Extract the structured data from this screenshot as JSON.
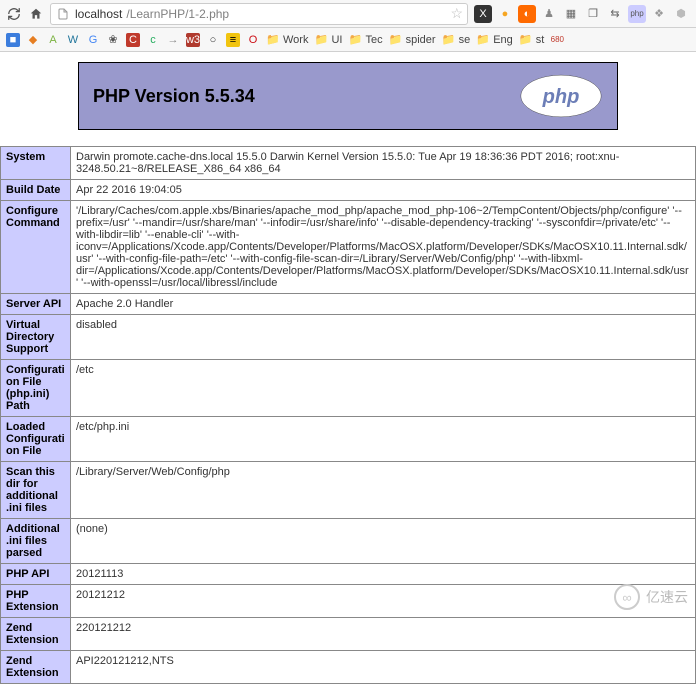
{
  "browser": {
    "url_host": "localhost",
    "url_path": "/LearnPHP/1-2.php",
    "extensions": [
      {
        "name": "x-ext",
        "glyph": "X",
        "bg": "#333",
        "fg": "#fff"
      },
      {
        "name": "orange-circle",
        "glyph": "●",
        "bg": "transparent",
        "fg": "#f6a623"
      },
      {
        "name": "orange-slash",
        "glyph": "◐",
        "bg": "#ff6a00",
        "fg": "#fff"
      },
      {
        "name": "chess",
        "glyph": "♟",
        "bg": "transparent",
        "fg": "#888"
      },
      {
        "name": "grid",
        "glyph": "▦",
        "bg": "transparent",
        "fg": "#666"
      },
      {
        "name": "window",
        "glyph": "❐",
        "bg": "transparent",
        "fg": "#666"
      },
      {
        "name": "arrows",
        "glyph": "⇆",
        "bg": "transparent",
        "fg": "#666"
      },
      {
        "name": "php",
        "glyph": "php",
        "bg": "#ccccff",
        "fg": "#555"
      },
      {
        "name": "grey1",
        "glyph": "❖",
        "bg": "transparent",
        "fg": "#999"
      },
      {
        "name": "grey2",
        "glyph": "⬢",
        "bg": "transparent",
        "fg": "#bbb"
      }
    ]
  },
  "bookmarks": [
    {
      "name": "blue-sq",
      "glyph": "■",
      "bg": "#3b7ddd",
      "fg": "#fff",
      "label": ""
    },
    {
      "name": "diamond",
      "glyph": "◆",
      "bg": "transparent",
      "fg": "#e67e22",
      "label": ""
    },
    {
      "name": "android",
      "glyph": "A",
      "bg": "transparent",
      "fg": "#7cb342",
      "label": ""
    },
    {
      "name": "wp",
      "glyph": "W",
      "bg": "transparent",
      "fg": "#21759b",
      "label": ""
    },
    {
      "name": "google",
      "glyph": "G",
      "bg": "transparent",
      "fg": "#4285f4",
      "label": ""
    },
    {
      "name": "paint",
      "glyph": "❀",
      "bg": "transparent",
      "fg": "#555",
      "label": ""
    },
    {
      "name": "c-red",
      "glyph": "C",
      "bg": "#c0392b",
      "fg": "#fff",
      "label": ""
    },
    {
      "name": "c-green",
      "glyph": "c",
      "bg": "transparent",
      "fg": "#27ae60",
      "label": ""
    },
    {
      "name": "arrow",
      "glyph": "→",
      "bg": "transparent",
      "fg": "#888",
      "label": ""
    },
    {
      "name": "w3",
      "glyph": "w3",
      "bg": "#b03a2e",
      "fg": "#fff",
      "label": ""
    },
    {
      "name": "github",
      "glyph": "○",
      "bg": "transparent",
      "fg": "#333",
      "label": ""
    },
    {
      "name": "yellow",
      "glyph": "≡",
      "bg": "#f1c40f",
      "fg": "#000",
      "label": ""
    },
    {
      "name": "opera",
      "glyph": "O",
      "bg": "transparent",
      "fg": "#cc0f16",
      "label": ""
    },
    {
      "name": "folder-work",
      "glyph": "📁",
      "bg": "transparent",
      "fg": "#6fa8dc",
      "label": "Work"
    },
    {
      "name": "folder-ui",
      "glyph": "📁",
      "bg": "transparent",
      "fg": "#6fa8dc",
      "label": "UI"
    },
    {
      "name": "folder-tec",
      "glyph": "📁",
      "bg": "transparent",
      "fg": "#6fa8dc",
      "label": "Tec"
    },
    {
      "name": "folder-spider",
      "glyph": "📁",
      "bg": "transparent",
      "fg": "#6fa8dc",
      "label": "spider"
    },
    {
      "name": "folder-se",
      "glyph": "📁",
      "bg": "transparent",
      "fg": "#6fa8dc",
      "label": "se"
    },
    {
      "name": "folder-eng",
      "glyph": "📁",
      "bg": "transparent",
      "fg": "#6fa8dc",
      "label": "Eng"
    },
    {
      "name": "folder-st",
      "glyph": "📁",
      "bg": "transparent",
      "fg": "#6fa8dc",
      "label": "st"
    },
    {
      "name": "red680",
      "glyph": "680",
      "bg": "transparent",
      "fg": "#c0392b",
      "label": ""
    }
  ],
  "php": {
    "title": "PHP Version 5.5.34",
    "rows": [
      {
        "k": "System",
        "v": "Darwin promote.cache-dns.local 15.5.0 Darwin Kernel Version 15.5.0: Tue Apr 19 18:36:36 PDT 2016; root:xnu-3248.50.21~8/RELEASE_X86_64 x86_64"
      },
      {
        "k": "Build Date",
        "v": "Apr 22 2016 19:04:05"
      },
      {
        "k": "Configure Command",
        "v": "'/Library/Caches/com.apple.xbs/Binaries/apache_mod_php/apache_mod_php-106~2/TempContent/Objects/php/configure' '--prefix=/usr' '--mandir=/usr/share/man' '--infodir=/usr/share/info' '--disable-dependency-tracking' '--sysconfdir=/private/etc' '--with-libdir=lib' '--enable-cli' '--with-iconv=/Applications/Xcode.app/Contents/Developer/Platforms/MacOSX.platform/Developer/SDKs/MacOSX10.11.Internal.sdk/usr' '--with-config-file-path=/etc' '--with-config-file-scan-dir=/Library/Server/Web/Config/php' '--with-libxml-dir=/Applications/Xcode.app/Contents/Developer/Platforms/MacOSX.platform/Developer/SDKs/MacOSX10.11.Internal.sdk/usr' '--with-openssl=/usr/local/libressl/include"
      },
      {
        "k": "Server API",
        "v": "Apache 2.0 Handler"
      },
      {
        "k": "Virtual Directory Support",
        "v": "disabled"
      },
      {
        "k": "Configuration File (php.ini) Path",
        "v": "/etc"
      },
      {
        "k": "Loaded Configuration File",
        "v": "/etc/php.ini"
      },
      {
        "k": "Scan this dir for additional .ini files",
        "v": "/Library/Server/Web/Config/php"
      },
      {
        "k": "Additional .ini files parsed",
        "v": "(none)"
      },
      {
        "k": "PHP API",
        "v": "20121113"
      },
      {
        "k": "PHP Extension",
        "v": "20121212"
      },
      {
        "k": "Zend Extension",
        "v": "220121212"
      },
      {
        "k": "Zend Extension",
        "v": "API220121212,NTS"
      }
    ]
  },
  "watermark": "亿速云"
}
